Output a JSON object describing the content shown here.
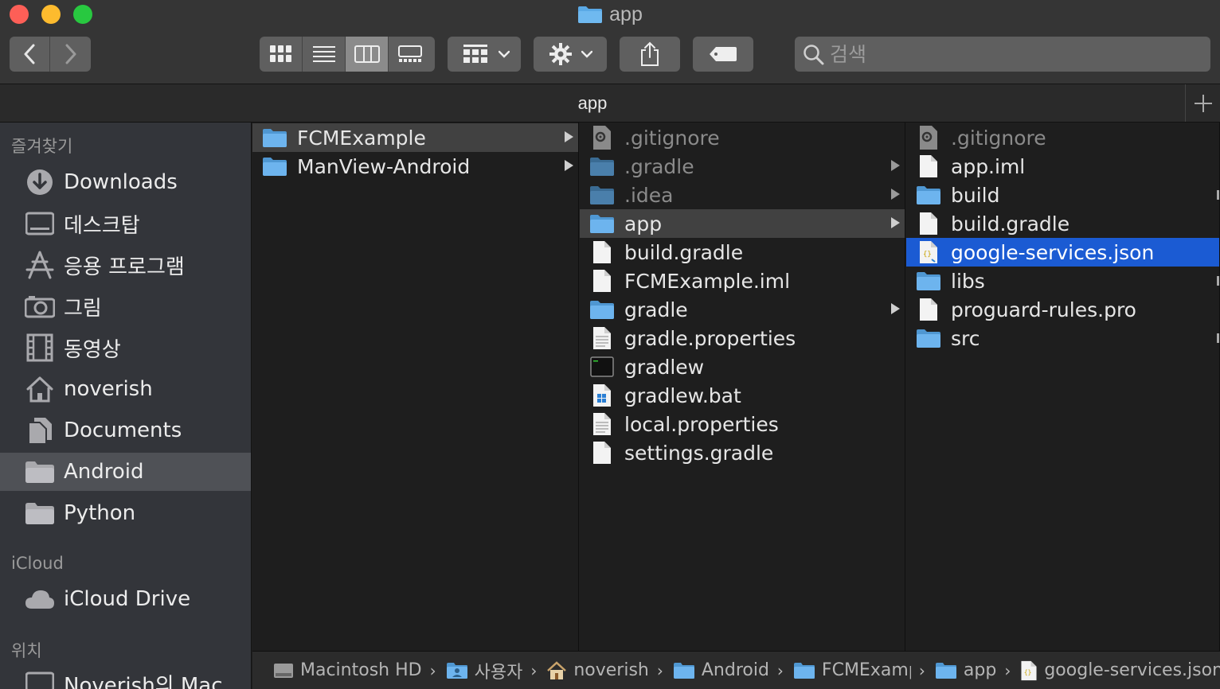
{
  "window": {
    "title": "app"
  },
  "toolbar": {
    "back_icon": "chevron-left-icon",
    "forward_icon": "chevron-right-icon",
    "view_modes": [
      "icon-view",
      "list-view",
      "column-view",
      "gallery-view"
    ],
    "active_view": "column-view",
    "search_placeholder": "검색"
  },
  "tabbar": {
    "tab_label": "app"
  },
  "sidebar": {
    "favorites_header": "즐겨찾기",
    "favorites": [
      {
        "label": "Downloads",
        "icon": "downloads-icon"
      },
      {
        "label": "데스크탑",
        "icon": "desktop-icon"
      },
      {
        "label": "응용 프로그램",
        "icon": "applications-icon"
      },
      {
        "label": "그림",
        "icon": "pictures-icon"
      },
      {
        "label": "동영상",
        "icon": "movies-icon"
      },
      {
        "label": "noverish",
        "icon": "home-icon"
      },
      {
        "label": "Documents",
        "icon": "documents-icon"
      },
      {
        "label": "Android",
        "icon": "folder-icon",
        "selected": true
      },
      {
        "label": "Python",
        "icon": "folder-icon"
      }
    ],
    "icloud_header": "iCloud",
    "icloud": [
      {
        "label": "iCloud Drive",
        "icon": "cloud-icon"
      }
    ],
    "locations_header": "위치",
    "locations": [
      {
        "label": "Noverish의 Mac",
        "icon": "computer-icon"
      }
    ]
  },
  "columns": {
    "col1": [
      {
        "name": "FCMExample",
        "type": "folder",
        "selected": true
      },
      {
        "name": "ManView-Android",
        "type": "folder"
      }
    ],
    "col2": [
      {
        "name": ".gitignore",
        "type": "settings-file",
        "hidden": true
      },
      {
        "name": ".gradle",
        "type": "folder",
        "hidden": true
      },
      {
        "name": ".idea",
        "type": "folder",
        "hidden": true
      },
      {
        "name": "app",
        "type": "folder",
        "selected": true
      },
      {
        "name": "build.gradle",
        "type": "file"
      },
      {
        "name": "FCMExample.iml",
        "type": "file"
      },
      {
        "name": "gradle",
        "type": "folder"
      },
      {
        "name": "gradle.properties",
        "type": "text-file"
      },
      {
        "name": "gradlew",
        "type": "exec-file"
      },
      {
        "name": "gradlew.bat",
        "type": "bat-file"
      },
      {
        "name": "local.properties",
        "type": "text-file"
      },
      {
        "name": "settings.gradle",
        "type": "file"
      }
    ],
    "col3": [
      {
        "name": ".gitignore",
        "type": "settings-file",
        "hidden": true
      },
      {
        "name": "app.iml",
        "type": "file"
      },
      {
        "name": "build",
        "type": "folder"
      },
      {
        "name": "build.gradle",
        "type": "file"
      },
      {
        "name": "google-services.json",
        "type": "json-file",
        "selected": true
      },
      {
        "name": "libs",
        "type": "folder"
      },
      {
        "name": "proguard-rules.pro",
        "type": "file"
      },
      {
        "name": "src",
        "type": "folder"
      }
    ]
  },
  "pathbar": [
    {
      "label": "Macintosh HD",
      "icon": "disk-icon"
    },
    {
      "label": "사용자",
      "icon": "users-folder-icon"
    },
    {
      "label": "noverish",
      "icon": "home-icon"
    },
    {
      "label": "Android",
      "icon": "folder-icon"
    },
    {
      "label": "FCMExample",
      "icon": "folder-icon"
    },
    {
      "label": "app",
      "icon": "folder-icon"
    },
    {
      "label": "google-services.json",
      "icon": "json-file-icon"
    }
  ],
  "colors": {
    "selection_blue": "#1b5bd3",
    "folder_blue": "#5aa9e6"
  }
}
